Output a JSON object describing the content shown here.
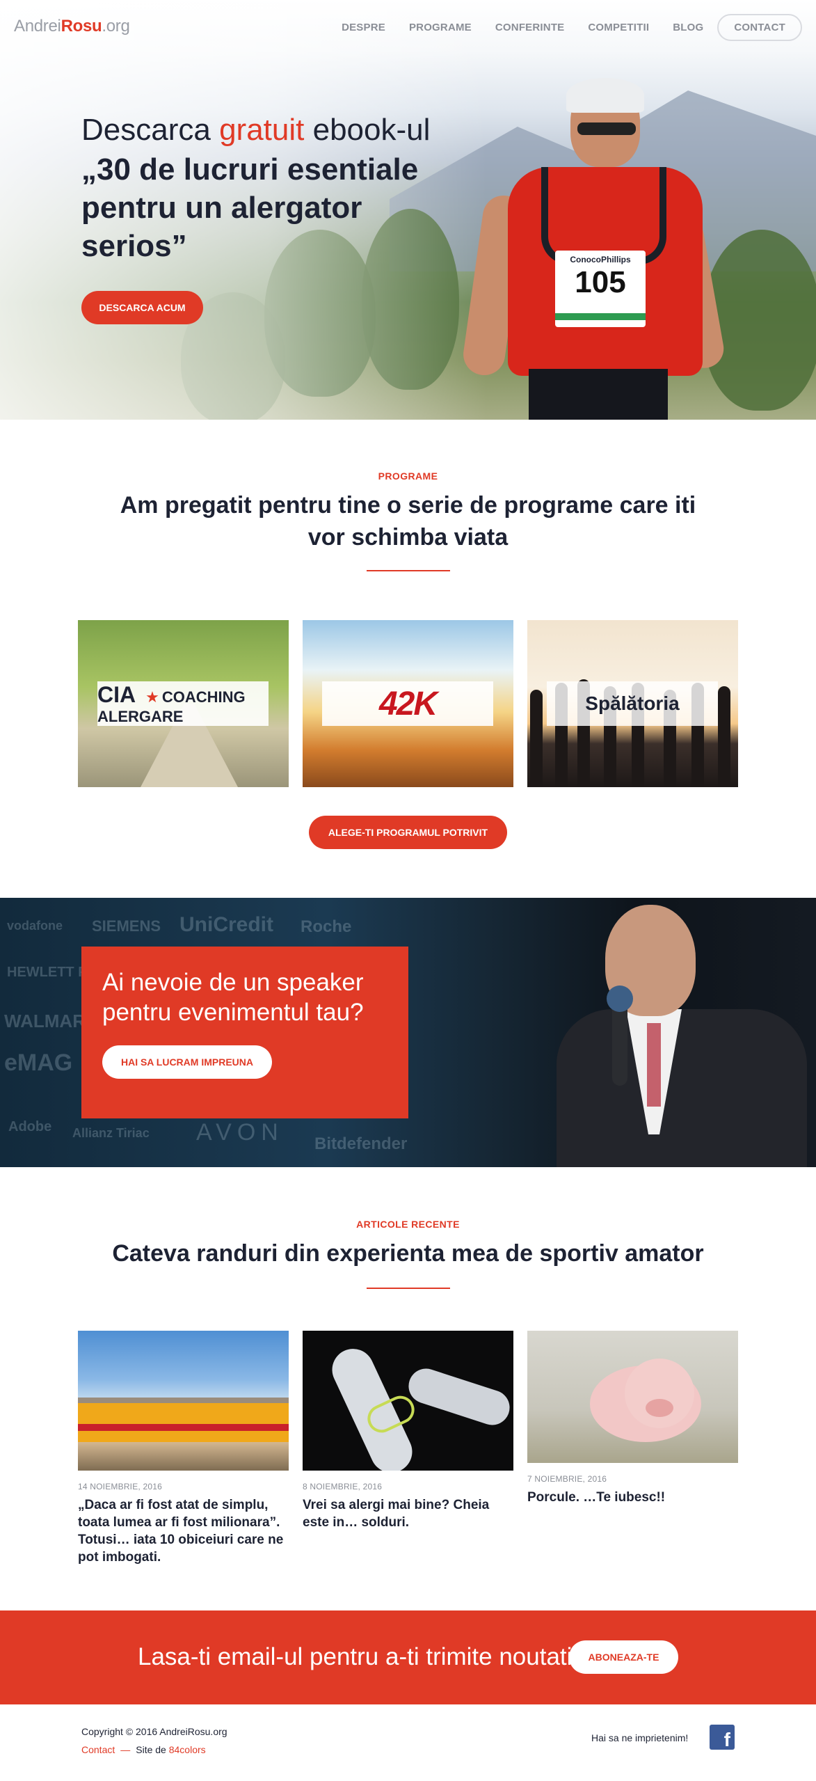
{
  "header": {
    "logo": {
      "part1": "Andrei",
      "part2": "Rosu",
      "part3": ".org"
    },
    "nav": [
      "DESPRE",
      "PROGRAME",
      "CONFERINTE",
      "COMPETITII",
      "BLOG",
      "CONTACT"
    ]
  },
  "hero": {
    "line1_prefix": "Descarca ",
    "line1_accent": "gratuit",
    "line1_suffix": " ebook-ul",
    "title": "„30 de lucruri esentiale pentru un alergator serios”",
    "button": "DESCARCA ACUM",
    "bib_sponsor": "ConocoPhillips",
    "bib_number": "105"
  },
  "programs": {
    "eyebrow": "PROGRAME",
    "title_regular": "Am pregatit pentru tine o serie de programe care iti ",
    "title_bold": "vor schimba viata",
    "cards": [
      {
        "logo_mark": "CIA",
        "logo_text": "COACHING ALERGARE"
      },
      {
        "logo_text": "42K"
      },
      {
        "logo_text": "Spălătoria"
      }
    ],
    "button": "ALEGE-TI PROGRAMUL POTRIVIT"
  },
  "speaker": {
    "title": "Ai nevoie de un speaker pentru evenimentul tau?",
    "button": "HAI SA LUCRAM IMPREUNA",
    "brands": [
      "vodafone",
      "SIEMENS",
      "UniCredit",
      "Roche",
      "HEWLETT PACKARD",
      "WALMART",
      "eMAG",
      "Adobe",
      "Allianz Tiriac",
      "AVON",
      "Bitdefender"
    ]
  },
  "articles": {
    "eyebrow": "ARTICOLE RECENTE",
    "title_regular": "Cateva randuri din experienta mea de ",
    "title_bold": "sportiv amator",
    "items": [
      {
        "date": "14 NOIEMBRIE, 2016",
        "title": "„Daca ar fi fost atat de simplu, toata lumea ar fi fost milionara”. Totusi… iata 10 obiceiuri care ne pot imbogati."
      },
      {
        "date": "8 NOIEMBRIE, 2016",
        "title": "Vrei sa alergi mai bine? Cheia este in… solduri."
      },
      {
        "date": "7 NOIEMBRIE, 2016",
        "title": "Porcule. …Te iubesc!!"
      }
    ]
  },
  "newsletter": {
    "text": "Lasa-ti email-ul pentru a-ti trimite noutati",
    "button": "ABONEAZA-TE"
  },
  "footer": {
    "copyright": "Copyright © 2016 AndreiRosu.org",
    "contact": "Contact",
    "separator": "—",
    "site_by": "Site de ",
    "agency": "84colors",
    "social_text": "Hai sa ne imprietenim!",
    "facebook_icon": "f"
  },
  "colors": {
    "accent": "#e03a26",
    "text": "#1d2233",
    "muted": "#8a8e96"
  }
}
